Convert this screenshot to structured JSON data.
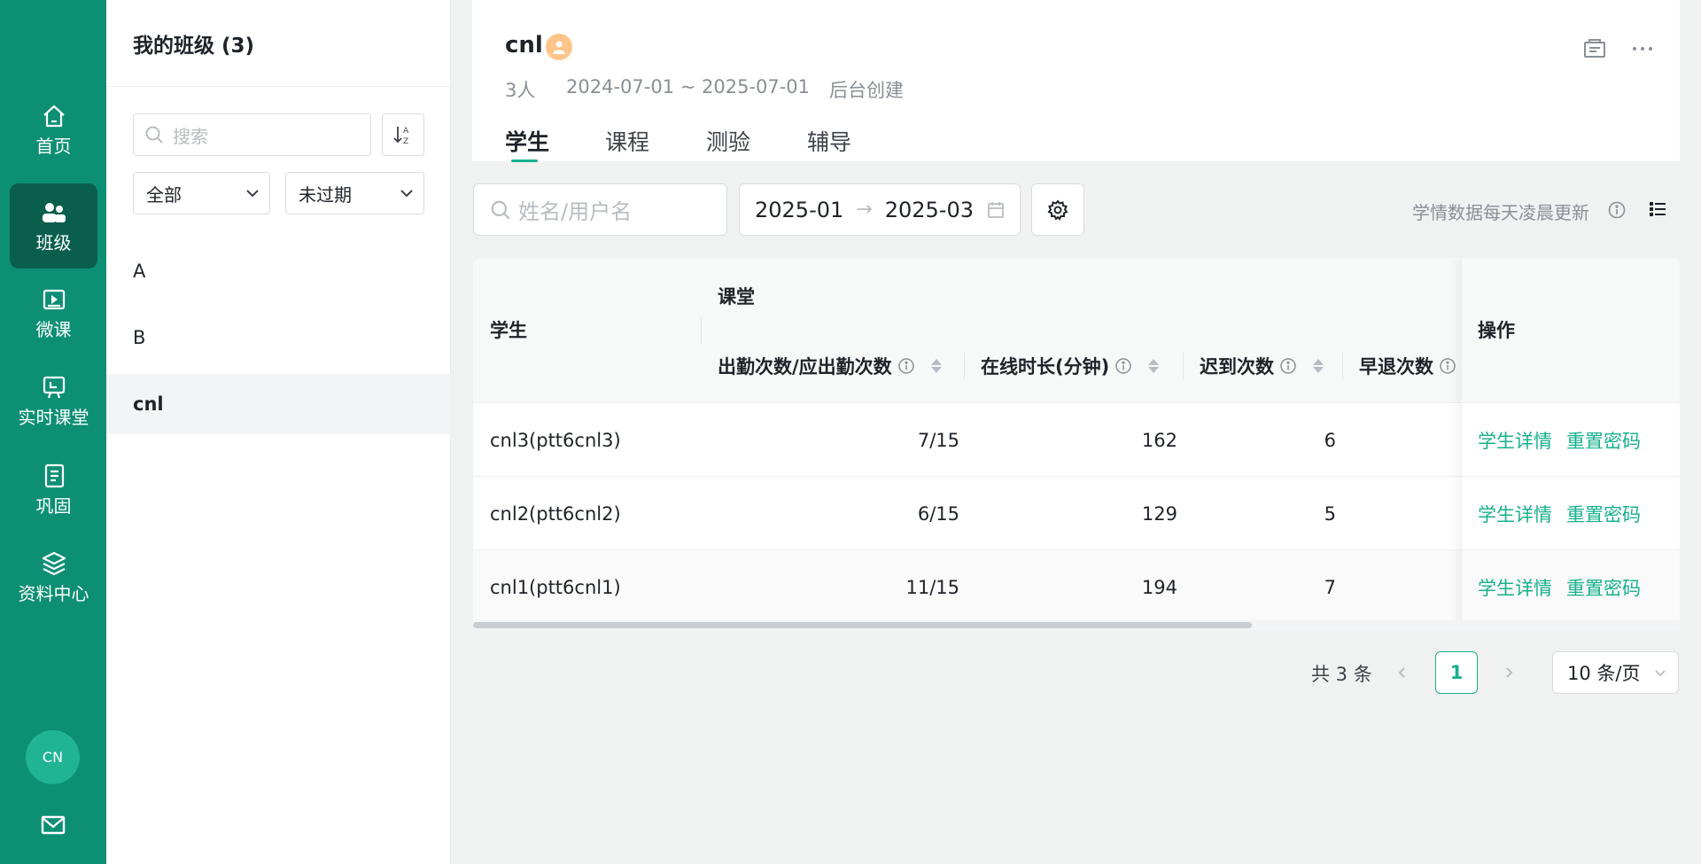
{
  "nav": {
    "items": [
      {
        "label": "首页",
        "icon": "home-icon"
      },
      {
        "label": "班级",
        "icon": "users-icon"
      },
      {
        "label": "微课",
        "icon": "video-icon"
      },
      {
        "label": "实时课堂",
        "icon": "live-classroom-icon"
      },
      {
        "label": "巩固",
        "icon": "notebook-icon"
      },
      {
        "label": "资料中心",
        "icon": "layers-icon"
      }
    ],
    "active": "班级",
    "avatar": "CN"
  },
  "classes": {
    "title": "我的班级 (3)",
    "search_placeholder": "搜索",
    "filter_scope": "全部",
    "filter_status": "未过期",
    "items": [
      "A",
      "B",
      "cnl"
    ],
    "selected": "cnl"
  },
  "class_header": {
    "name": "cnl",
    "student_count": "3人",
    "date_range": "2024-07-01 ~ 2025-07-01",
    "source": "后台创建",
    "tabs": [
      "学生",
      "课程",
      "测验",
      "辅导"
    ],
    "active_tab": "学生"
  },
  "toolbar": {
    "name_placeholder": "姓名/用户名",
    "date_start": "2025-01",
    "date_separator": "→",
    "date_end": "2025-03",
    "update_note": "学情数据每天凌晨更新"
  },
  "table": {
    "col_student": "学生",
    "group_label": "课堂",
    "col_attendance": "出勤次数/应出勤次数",
    "col_online": "在线时长(分钟)",
    "col_late": "迟到次数",
    "col_early": "早退次数",
    "col_actions": "操作",
    "rows": [
      {
        "student": "cnl3(ptt6cnl3)",
        "attendance": "7/15",
        "online": "162",
        "late": "6"
      },
      {
        "student": "cnl2(ptt6cnl2)",
        "attendance": "6/15",
        "online": "129",
        "late": "5"
      },
      {
        "student": "cnl1(ptt6cnl1)",
        "attendance": "11/15",
        "online": "194",
        "late": "7"
      }
    ],
    "action_detail": "学生详情",
    "action_reset": "重置密码"
  },
  "pagination": {
    "total": "共 3 条",
    "current_page": "1",
    "page_size": "10 条/页"
  },
  "colors": {
    "brand": "#0d8f74",
    "accent": "#17b08e",
    "rail_active": "#0a5e4c"
  }
}
